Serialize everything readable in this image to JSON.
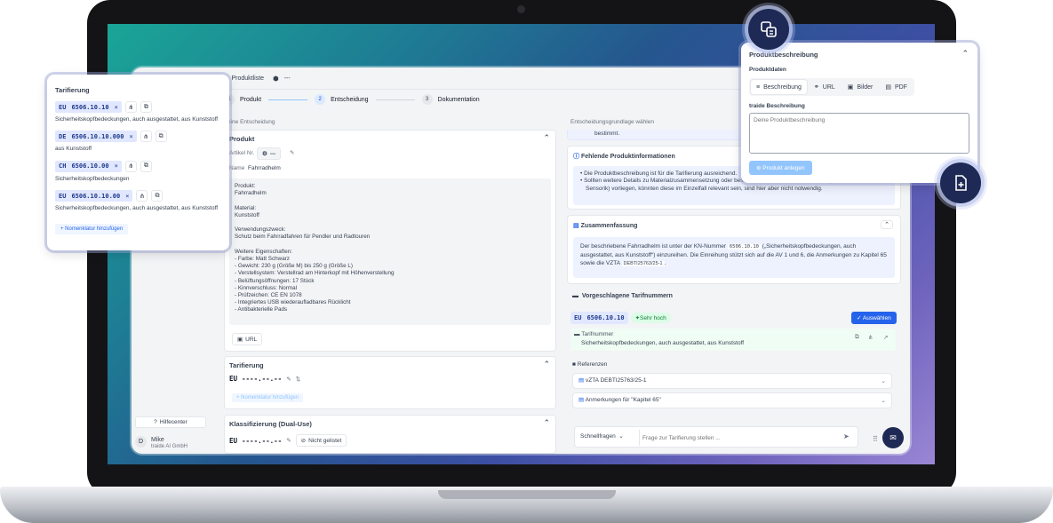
{
  "topbar": {
    "breadcrumb": "Produktliste",
    "more": "---"
  },
  "steps": [
    {
      "num": "1",
      "label": "Produkt"
    },
    {
      "num": "2",
      "label": "Entscheidung"
    },
    {
      "num": "3",
      "label": "Dokumentation"
    }
  ],
  "left_header": "eine Entscheidung",
  "right_header": "Entscheidungsgrundlage wählen",
  "produkt": {
    "title": "Produkt",
    "artikel_label": "Artikel Nr.",
    "artikel_value": "---",
    "name_label": "Name",
    "name_value": "Fahrradhelm",
    "description_lines": [
      "Produkt:",
      "Fahrradhelm",
      "",
      "Material:",
      "Kunststoff",
      "",
      "Verwendungszweck:",
      "Schutz beim Fahrradfahren für Pendler und Radtouren",
      "",
      "Weitere Eigenschaften:",
      "- Farbe: Matt Schwarz",
      "- Gewicht: 230 g (Größe M) bis 250 g (Größe L)",
      "- Verstellsystem: Verstellrad am Hinterkopf mit Höhenverstellung",
      "- Belüftungsöffnungen: 17 Stück",
      "- Kinnverschluss: Normal",
      "- Prüfzeichen: CE EN 1078",
      "- Integriertes USB wiederaufladbares Rücklicht",
      "- Antibakterielle Pads"
    ],
    "url_button": "URL"
  },
  "tarifierung_card": {
    "title": "Tarifierung",
    "code_prefix": "EU",
    "code_value": "----.--.--",
    "add_label": "Nomenklatur hinzufügen"
  },
  "klassifizierung": {
    "title": "Klassifizierung (Dual-Use)",
    "code_prefix": "EU",
    "code_value": "----.--.--",
    "status": "Nicht gelistet"
  },
  "sidebar": {
    "help": "Hilfecenter",
    "user_initial": "D",
    "user_name": "Mike",
    "company": "traide AI GmbH"
  },
  "right": {
    "prev_line": "bestimmt.",
    "missing_title": "Fehlende Produktinformationen",
    "missing_items": [
      "Die Produktbeschreibung ist für die Tarifierung ausreichend.",
      "Sollten weitere Details zu Materialzusammensetzung oder besonderen elektrischen Funktionen (z. B. Kommunikation, Sensorik) vorliegen, könnten diese im Einzelfall relevant sein, sind hier aber nicht notwendig."
    ],
    "summary_title": "Zusammenfassung",
    "summary_text1": "Der beschriebene Fahrradhelm ist unter der KN-Nummer",
    "summary_code": "6506.10.10",
    "summary_text2": "(„Sicherheitskopfbedeckungen, auch ausgestattet, aus Kunststoff“) einzureihen. Die Einreihung stützt sich auf die AV 1 und 6, die Anmerkungen zu Kapitel 65 sowie die VZTA",
    "summary_ref": "DEBTI25763/25-1",
    "summary_end": ".",
    "suggest_title": "Vorgeschlagene Tarifnummern",
    "suggest_prefix": "EU",
    "suggest_code": "6506.10.10",
    "confidence": "Sehr hoch",
    "select_btn": "Auswählen",
    "tarif_label": "Tarifnummer",
    "tarif_desc": "Sicherheitskopfbedeckungen, auch ausgestattet, aus Kunststoff",
    "refs_title": "Referenzen",
    "refs": [
      "vZTA DEBTI25763/25-1",
      "Anmerkungen für \"Kapitel 65\""
    ],
    "quick": "Schnellfragen",
    "ask_placeholder": "Frage zur Tarifierung stellen ..."
  },
  "tarif_overlay": {
    "title": "Tarifierung",
    "entries": [
      {
        "region": "EU",
        "code": "6506.10.10",
        "desc": "Sicherheitskopfbedeckungen, auch ausgestattet, aus Kunststoff"
      },
      {
        "region": "DE",
        "code": "6506.10.10.000",
        "desc": "aus Kunststoff"
      },
      {
        "region": "CH",
        "code": "6506.10.00",
        "desc": "Sicherheitskopfbedeckungen"
      },
      {
        "region": "EU",
        "code": "6506.10.10.00",
        "desc": "Sicherheitskopfbedeckungen, auch ausgestattet, aus Kunststoff"
      }
    ],
    "add_label": "Nomenklatur hinzufügen"
  },
  "product_overlay": {
    "title": "Produktbeschreibung",
    "section": "Produktdaten",
    "tabs": [
      "Beschreibung",
      "URL",
      "Bilder",
      "PDF"
    ],
    "field_label": "traide Beschreibung",
    "placeholder": "Deine Produktbeschreibung",
    "submit": "Produkt anlegen"
  },
  "colors": {
    "accent": "#2563eb",
    "success": "#16a34a",
    "dark_navy": "#1e2a55"
  }
}
